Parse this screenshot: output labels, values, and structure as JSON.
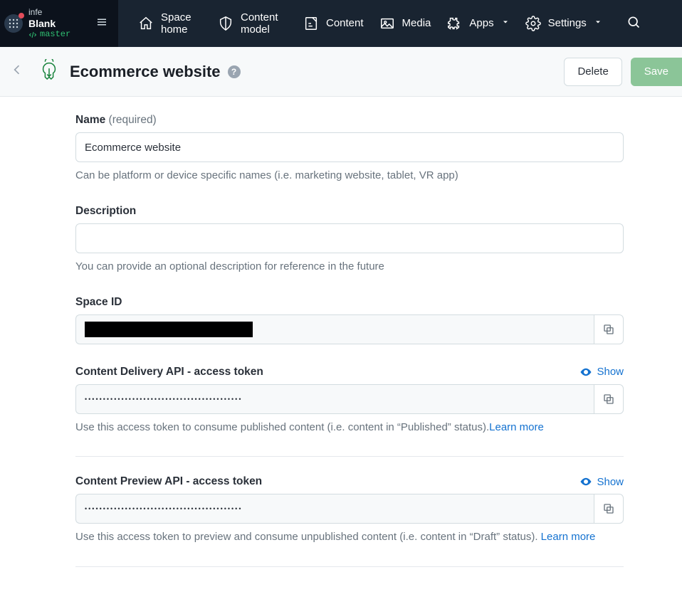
{
  "org": {
    "line1": "infe",
    "space_name": "Blank",
    "env": "master"
  },
  "nav": {
    "space_home": "Space home",
    "content_model": "Content model",
    "content": "Content",
    "media": "Media",
    "apps": "Apps",
    "settings": "Settings"
  },
  "page": {
    "title": "Ecommerce website",
    "delete": "Delete",
    "save": "Save"
  },
  "fields": {
    "name": {
      "label": "Name",
      "required": "(required)",
      "value": "Ecommerce website",
      "helper": "Can be platform or device specific names (i.e. marketing website, tablet, VR app)"
    },
    "description": {
      "label": "Description",
      "value": "",
      "helper": "You can provide an optional description for reference in the future"
    },
    "space_id": {
      "label": "Space ID"
    },
    "cda": {
      "label": "Content Delivery API - access token",
      "show": "Show",
      "masked": "•••••••••••••••••••••••••••••••••••••••••••",
      "helper": "Use this access token to consume published content (i.e. content in “Published” status).",
      "learn": "Learn more"
    },
    "cpa": {
      "label": "Content Preview API - access token",
      "show": "Show",
      "masked": "•••••••••••••••••••••••••••••••••••••••••••",
      "helper": "Use this access token to preview and consume unpublished content (i.e. content in “Draft” status). ",
      "learn": "Learn more"
    }
  }
}
